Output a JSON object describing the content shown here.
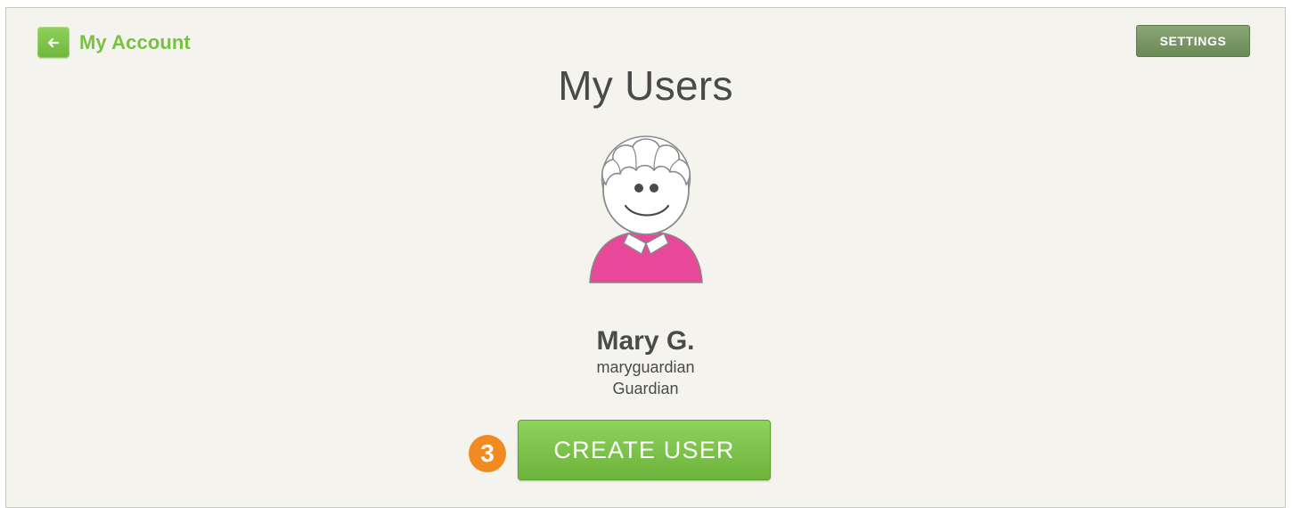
{
  "header": {
    "back_label": "My Account",
    "settings_label": "SETTINGS"
  },
  "page": {
    "title": "My Users"
  },
  "user": {
    "name": "Mary G.",
    "username": "maryguardian",
    "role": "Guardian",
    "avatar_icon": "guardian-avatar-icon",
    "shirt_color": "#e8489a"
  },
  "actions": {
    "step_number": "3",
    "create_user_label": "CREATE USER"
  },
  "colors": {
    "accent_green": "#7ac143",
    "settings_green": "#6f8f5b",
    "badge_orange": "#f18a21",
    "background": "#f4f3ee"
  }
}
